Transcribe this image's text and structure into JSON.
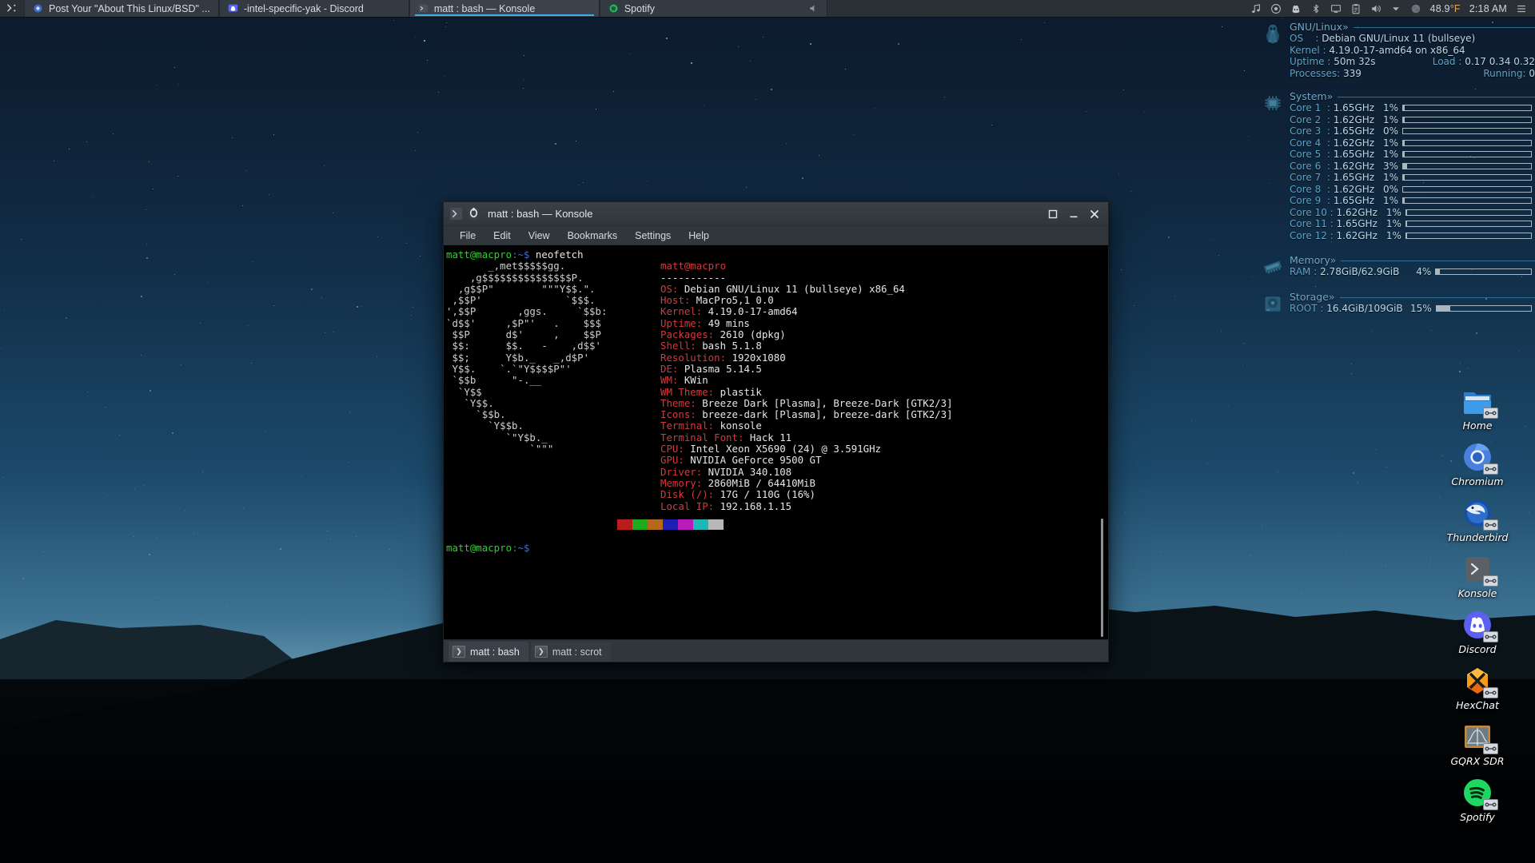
{
  "taskbar": {
    "launcher_icon": "konsole-launcher-icon",
    "tasks": [
      {
        "label": "Post Your \"About This Linux/BSD\" ...",
        "icon": "browser-icon",
        "active": false
      },
      {
        "label": "-intel-specific-yak - Discord",
        "icon": "discord-icon",
        "active": false
      },
      {
        "label": "matt : bash — Konsole",
        "icon": "konsole-icon",
        "active": true
      },
      {
        "label": "Spotify",
        "icon": "spotify-icon",
        "active": false
      }
    ],
    "tray": {
      "icons": [
        "music-note-icon",
        "record-icon",
        "discord-icon",
        "bluetooth-icon",
        "display-icon",
        "clipboard-icon",
        "volume-icon",
        "chevron-down-icon",
        "weather-moon-icon"
      ],
      "temperature": "48.9",
      "temperature_unit": "°F",
      "clock": "2:18 AM",
      "menu_icon": "hamburger-icon"
    }
  },
  "conky": {
    "gnulinux": {
      "title": "GNU/Linux»",
      "icon": "tux-penguin-icon",
      "rows": [
        {
          "label": "OS",
          "sep": "    : ",
          "value": "Debian GNU/Linux 11 (bullseye)"
        },
        {
          "label": "Kernel",
          "sep": " : ",
          "value": "4.19.0-17-amd64 on x86_64"
        }
      ],
      "uptime_label": "Uptime",
      "uptime_value": "50m 32s",
      "load_label": "Load",
      "load_value": "0.17 0.34 0.32",
      "processes_label": "Processes:",
      "processes_value": "339",
      "running_label": "Running:",
      "running_value": "0"
    },
    "system": {
      "title": "System»",
      "icon": "cpu-chip-icon",
      "cores": [
        {
          "name": "Core 1 ",
          "freq": "1.65GHz",
          "pct": "1%",
          "value": 1
        },
        {
          "name": "Core 2 ",
          "freq": "1.62GHz",
          "pct": "1%",
          "value": 1
        },
        {
          "name": "Core 3 ",
          "freq": "1.65GHz",
          "pct": "0%",
          "value": 0
        },
        {
          "name": "Core 4 ",
          "freq": "1.62GHz",
          "pct": "1%",
          "value": 1
        },
        {
          "name": "Core 5 ",
          "freq": "1.65GHz",
          "pct": "1%",
          "value": 1
        },
        {
          "name": "Core 6 ",
          "freq": "1.62GHz",
          "pct": "3%",
          "value": 3
        },
        {
          "name": "Core 7 ",
          "freq": "1.65GHz",
          "pct": "1%",
          "value": 1
        },
        {
          "name": "Core 8 ",
          "freq": "1.62GHz",
          "pct": "0%",
          "value": 0
        },
        {
          "name": "Core 9 ",
          "freq": "1.65GHz",
          "pct": "1%",
          "value": 1
        },
        {
          "name": "Core 10",
          "freq": "1.62GHz",
          "pct": "1%",
          "value": 1
        },
        {
          "name": "Core 11",
          "freq": "1.65GHz",
          "pct": "1%",
          "value": 1
        },
        {
          "name": "Core 12",
          "freq": "1.62GHz",
          "pct": "1%",
          "value": 1
        }
      ]
    },
    "memory": {
      "title": "Memory»",
      "icon": "ram-stick-icon",
      "label": "RAM :",
      "value": "2.78GiB/62.9GiB",
      "pct": "4%",
      "fill": 4
    },
    "storage": {
      "title": "Storage»",
      "icon": "hard-disk-icon",
      "label": "ROOT :",
      "value": "16.4GiB/109GiB",
      "pct": "15%",
      "fill": 15
    }
  },
  "desktop_icons": [
    {
      "label": "Home",
      "icon": "folder-home-icon"
    },
    {
      "label": "Chromium",
      "icon": "chromium-icon"
    },
    {
      "label": "Thunderbird",
      "icon": "thunderbird-icon"
    },
    {
      "label": "Konsole",
      "icon": "konsole-icon"
    },
    {
      "label": "Discord",
      "icon": "discord-icon"
    },
    {
      "label": "HexChat",
      "icon": "hexchat-icon"
    },
    {
      "label": "GQRX SDR",
      "icon": "gqrx-icon"
    },
    {
      "label": "Spotify",
      "icon": "spotify-icon"
    }
  ],
  "konsole": {
    "title": "matt : bash — Konsole",
    "title_icons": [
      "terminal-prompt-icon",
      "konsole-icon"
    ],
    "window_buttons": [
      "maximize-button",
      "minimize-button",
      "close-button"
    ],
    "menu": [
      "File",
      "Edit",
      "View",
      "Bookmarks",
      "Settings",
      "Help"
    ],
    "tabs": [
      {
        "label": "matt : bash",
        "active": true
      },
      {
        "label": "matt : scrot",
        "active": false
      }
    ],
    "terminal": {
      "prompt_user": "matt@macpro",
      "prompt_path": ":~$",
      "command": "neofetch",
      "final_prompt_user": "matt@macpro",
      "final_prompt_path": ":~$",
      "ascii_art": [
        "       _,met$$$$$gg.",
        "    ,g$$$$$$$$$$$$$$$P.",
        "  ,g$$P\"        \"\"\"Y$$.\".",
        " ,$$P'              `$$$.",
        "',$$P       ,ggs.     `$$b:",
        "`d$$'     ,$P\"'   .    $$$",
        " $$P      d$'     ,    $$P",
        " $$:      $$.   -    ,d$$'",
        " $$;      Y$b._   _,d$P'",
        " Y$$.    `.`\"Y$$$$P\"'",
        " `$$b      \"-.__",
        "  `Y$$",
        "   `Y$$.",
        "     `$$b.",
        "       `Y$$b.",
        "          `\"Y$b._",
        "              `\"\"\""
      ],
      "header_user": "matt@macpro",
      "header_rule": "-----------",
      "info": [
        {
          "key": "OS",
          "value": "Debian GNU/Linux 11 (bullseye) x86_64"
        },
        {
          "key": "Host",
          "value": "MacPro5,1 0.0"
        },
        {
          "key": "Kernel",
          "value": "4.19.0-17-amd64"
        },
        {
          "key": "Uptime",
          "value": "49 mins"
        },
        {
          "key": "Packages",
          "value": "2610 (dpkg)"
        },
        {
          "key": "Shell",
          "value": "bash 5.1.8"
        },
        {
          "key": "Resolution",
          "value": "1920x1080"
        },
        {
          "key": "DE",
          "value": "Plasma 5.14.5"
        },
        {
          "key": "WM",
          "value": "KWin"
        },
        {
          "key": "WM Theme",
          "value": "plastik"
        },
        {
          "key": "Theme",
          "value": "Breeze Dark [Plasma], Breeze-Dark [GTK2/3]"
        },
        {
          "key": "Icons",
          "value": "breeze-dark [Plasma], breeze-dark [GTK2/3]"
        },
        {
          "key": "Terminal",
          "value": "konsole"
        },
        {
          "key": "Terminal Font",
          "value": "Hack 11"
        },
        {
          "key": "CPU",
          "value": "Intel Xeon X5690 (24) @ 3.591GHz"
        },
        {
          "key": "GPU",
          "value": "NVIDIA GeForce 9500 GT"
        },
        {
          "key": "Driver",
          "value": "NVIDIA 340.108"
        },
        {
          "key": "Memory",
          "value": "2860MiB / 64410MiB"
        },
        {
          "key": "Disk (/)",
          "value": "17G / 110G (16%)"
        },
        {
          "key": "Local IP",
          "value": "192.168.1.15"
        }
      ],
      "palette": [
        "#b81c1c",
        "#1eaa1e",
        "#b3681b",
        "#1f1fb5",
        "#b81cb8",
        "#1cb8b8",
        "#b8b8b8"
      ]
    }
  },
  "colors": {
    "accent": "#3daee9",
    "panel_bg": "#2b2f36",
    "window_bg": "#31363b",
    "terminal_bg": "#000000",
    "neofetch_key": "#d43a3a",
    "prompt_green": "#32cd32",
    "conky_text": "#5fa3c6"
  }
}
